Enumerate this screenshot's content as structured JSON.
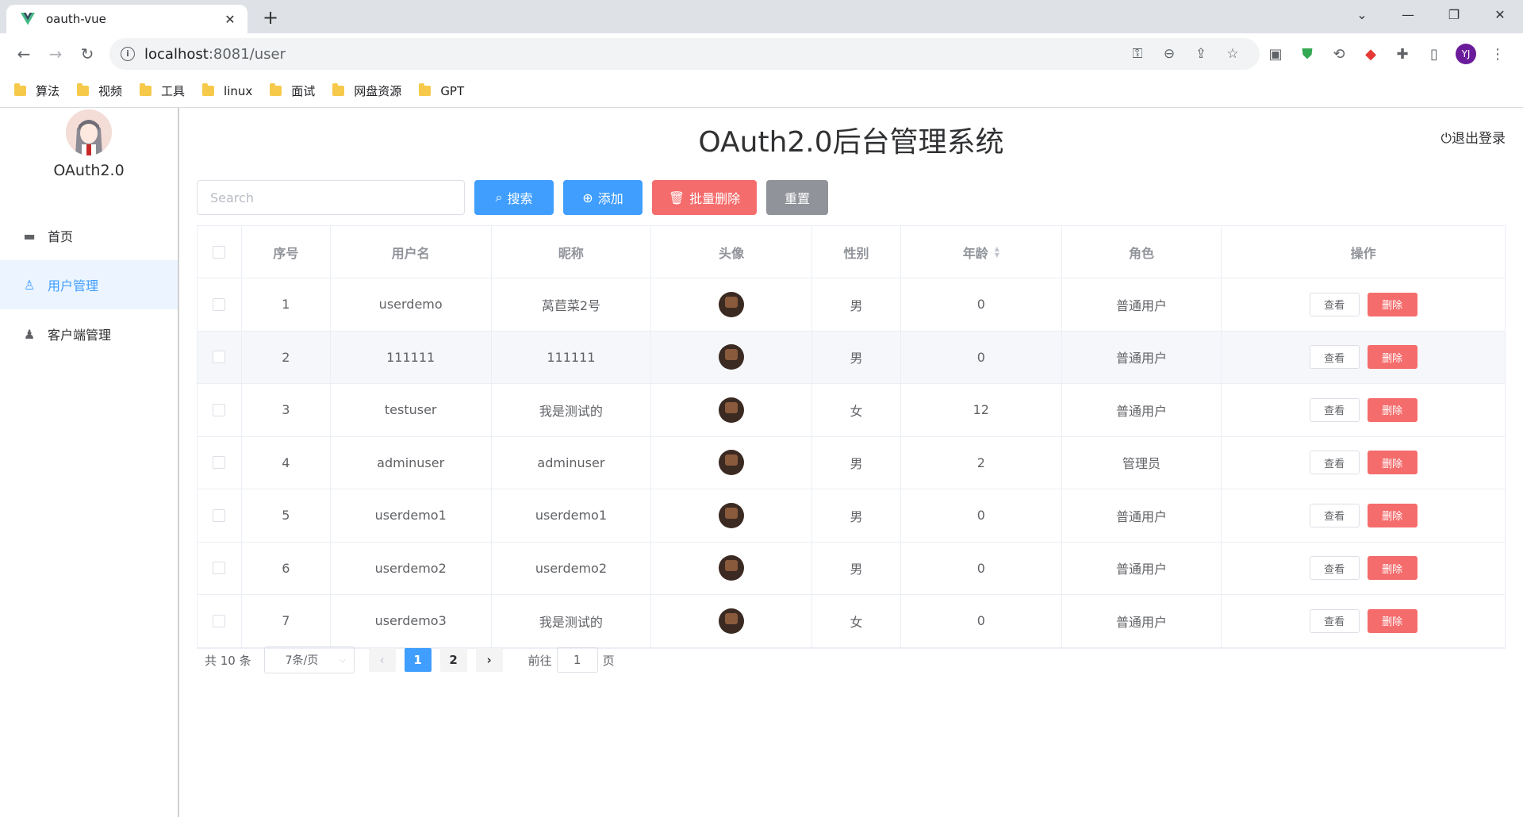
{
  "browser": {
    "tab_title": "oauth-vue",
    "url_host": "localhost",
    "url_path": ":8081/user",
    "profile_initials": "YJ",
    "bookmarks": [
      "算法",
      "视频",
      "工具",
      "linux",
      "面试",
      "网盘资源",
      "GPT"
    ]
  },
  "sidebar": {
    "logo_text": "OAuth2.0",
    "items": [
      {
        "label": "首页",
        "icon": "monitor-icon"
      },
      {
        "label": "用户管理",
        "icon": "user-icon"
      },
      {
        "label": "客户端管理",
        "icon": "user-filled-icon"
      }
    ]
  },
  "header": {
    "title": "OAuth2.0后台管理系统",
    "logout": "退出登录"
  },
  "toolbar": {
    "search_placeholder": "Search",
    "search_btn": "搜索",
    "add_btn": "添加",
    "batch_delete_btn": "批量删除",
    "reset_btn": "重置"
  },
  "table": {
    "columns": [
      "",
      "序号",
      "用户名",
      "昵称",
      "头像",
      "性别",
      "年龄",
      "角色",
      "操作"
    ],
    "view_label": "查看",
    "delete_label": "删除",
    "rows": [
      {
        "id": "1",
        "username": "userdemo",
        "nickname": "莴苣菜2号",
        "gender": "男",
        "age": "0",
        "role": "普通用户"
      },
      {
        "id": "2",
        "username": "111111",
        "nickname": "111111",
        "gender": "男",
        "age": "0",
        "role": "普通用户"
      },
      {
        "id": "3",
        "username": "testuser",
        "nickname": "我是测试的",
        "gender": "女",
        "age": "12",
        "role": "普通用户"
      },
      {
        "id": "4",
        "username": "adminuser",
        "nickname": "adminuser",
        "gender": "男",
        "age": "2",
        "role": "管理员"
      },
      {
        "id": "5",
        "username": "userdemo1",
        "nickname": "userdemo1",
        "gender": "男",
        "age": "0",
        "role": "普通用户"
      },
      {
        "id": "6",
        "username": "userdemo2",
        "nickname": "userdemo2",
        "gender": "男",
        "age": "0",
        "role": "普通用户"
      },
      {
        "id": "7",
        "username": "userdemo3",
        "nickname": "我是测试的",
        "gender": "女",
        "age": "0",
        "role": "普通用户"
      }
    ]
  },
  "pagination": {
    "total": "共 10 条",
    "page_size": "7条/页",
    "pages": [
      "1",
      "2"
    ],
    "current_page": "1",
    "goto_label": "前往",
    "goto_value": "1",
    "goto_suffix": "页"
  }
}
